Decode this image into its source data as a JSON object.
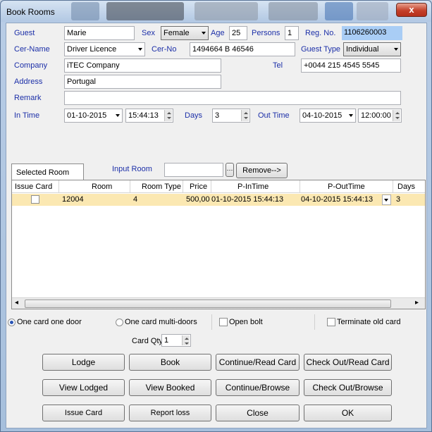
{
  "window": {
    "title": "Book Rooms",
    "close_glyph": "x"
  },
  "form": {
    "guest_label": "Guest",
    "guest_value": "Marie",
    "sex_label": "Sex",
    "sex_value": "Female",
    "age_label": "Age",
    "age_value": "25",
    "persons_label": "Persons",
    "persons_value": "1",
    "regno_label": "Reg. No.",
    "regno_value": "1106260003",
    "cername_label": "Cer-Name",
    "cername_value": "Driver Licence",
    "cerno_label": "Cer-No",
    "cerno_value": "1494664 B 46546",
    "guesttype_label": "Guest Type",
    "guesttype_value": "Individual",
    "company_label": "Company",
    "company_value": "iTEC Company",
    "tel_label": "Tel",
    "tel_value": "+0044 215 4545 5545",
    "address_label": "Address",
    "address_value": "Portugal",
    "remark_label": "Remark",
    "remark_value": "",
    "intime_label": "In Time",
    "intime_date": "01-10-2015",
    "intime_time": "15:44:13",
    "days_label": "Days",
    "days_value": "3",
    "outtime_label": "Out Time",
    "outtime_date": "04-10-2015",
    "outtime_time": "12:00:00"
  },
  "room_tabs": {
    "selected_tab": "Selected Room",
    "input_label": "Input Room",
    "input_value": "",
    "remove_label": "Remove-->"
  },
  "grid": {
    "columns": [
      "Issue Card",
      "Room",
      "Room Type",
      "Price",
      "P-InTime",
      "P-OutTime",
      "Days"
    ],
    "rows": [
      {
        "room": "12004",
        "room_type": "4",
        "price": "500,00",
        "p_intime": "01-10-2015 15:44:13",
        "p_outtime": "04-10-2015 15:44:13",
        "days": "3"
      }
    ]
  },
  "options": {
    "one_card_one_door": "One card one door",
    "one_card_multi_doors": "One card multi-doors",
    "open_bolt": "Open bolt",
    "terminate_old_card": "Terminate old card",
    "card_qty_label": "Card Qty",
    "card_qty_value": "1"
  },
  "buttons": {
    "lodge": "Lodge",
    "book": "Book",
    "continue_read": "Continue/Read Card",
    "checkout_read": "Check Out/Read Card",
    "view_lodged": "View Lodged",
    "view_booked": "View Booked",
    "continue_browse": "Continue/Browse",
    "checkout_browse": "Check Out/Browse",
    "issue_card": "Issue Card",
    "report_loss": "Report loss",
    "close": "Close",
    "ok": "OK"
  }
}
